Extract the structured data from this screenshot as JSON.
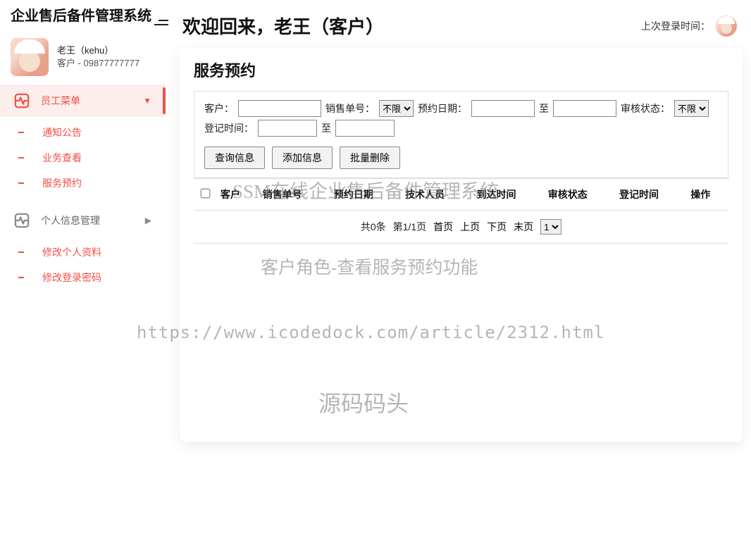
{
  "app": {
    "name": "企业售后备件管理系统"
  },
  "user": {
    "display_name": "老王（kehu）",
    "role_phone": "客户 - 09877777777"
  },
  "sidebar": {
    "employee_menu": "员工菜单",
    "items": [
      {
        "label": "通知公告"
      },
      {
        "label": "业务查看"
      },
      {
        "label": "服务预约"
      }
    ],
    "personal_menu": "个人信息管理",
    "personal_items": [
      {
        "label": "修改个人资料"
      },
      {
        "label": "修改登录密码"
      }
    ]
  },
  "header": {
    "welcome": "欢迎回来，老王（客户）",
    "last_login_label": "上次登录时间："
  },
  "page": {
    "title": "服务预约"
  },
  "filters": {
    "customer_label": "客户：",
    "customer_value": "",
    "sales_order_label": "销售单号：",
    "sales_order_option": "不限",
    "appoint_date_label": "预约日期：",
    "appoint_date_from": "",
    "to_label": "至",
    "appoint_date_to": "",
    "audit_status_label": "审核状态：",
    "audit_status_option": "不限",
    "register_time_label": "登记时间：",
    "register_time_from": "",
    "register_time_to": ""
  },
  "buttons": {
    "query": "查询信息",
    "add": "添加信息",
    "batch_delete": "批量删除"
  },
  "table": {
    "headers": [
      "客户",
      "销售单号",
      "预约日期",
      "技术人员",
      "到达时间",
      "审核状态",
      "登记时间",
      "操作"
    ]
  },
  "pagination": {
    "total_text": "共0条",
    "page_text": "第1/1页",
    "first": "首页",
    "prev": "上页",
    "next": "下页",
    "last": "末页",
    "page_option": "1"
  },
  "watermarks": {
    "wm1": "SSM在线企业售后备件管理系统",
    "wm2": "客户角色-查看服务预约功能",
    "wm3": "https://www.icodedock.com/article/2312.html",
    "wm4": "源码码头"
  }
}
